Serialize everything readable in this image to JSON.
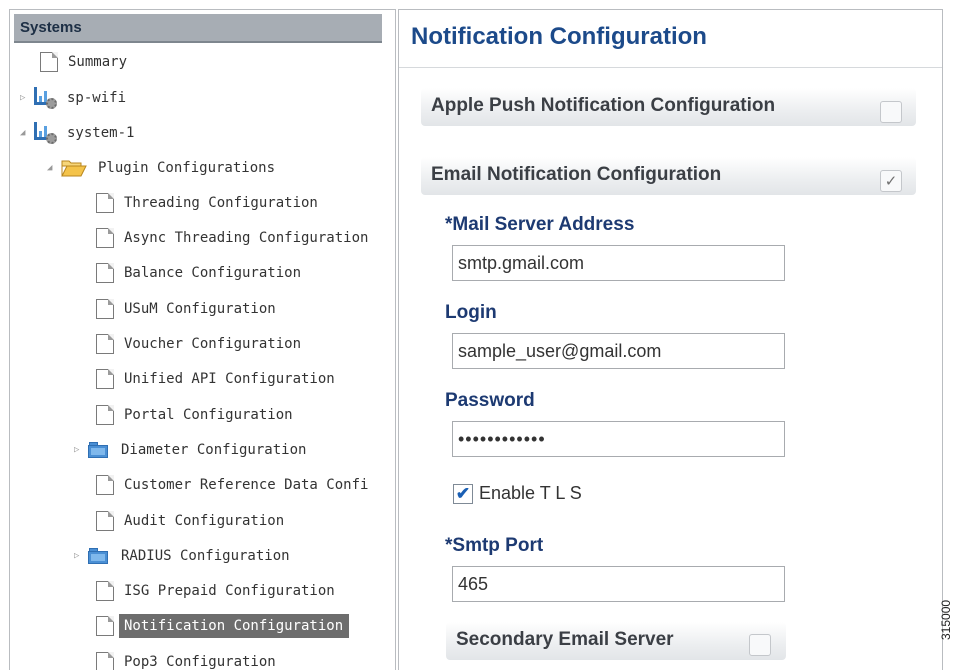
{
  "sidebar": {
    "header": "Systems",
    "items": [
      {
        "label": "Summary"
      },
      {
        "label": "sp-wifi"
      },
      {
        "label": "system-1"
      },
      {
        "label": "Plugin Configurations"
      },
      {
        "label": "Threading Configuration"
      },
      {
        "label": "Async Threading Configuration"
      },
      {
        "label": "Balance Configuration"
      },
      {
        "label": "USuM Configuration"
      },
      {
        "label": "Voucher Configuration"
      },
      {
        "label": "Unified API Configuration"
      },
      {
        "label": "Portal Configuration"
      },
      {
        "label": "Diameter Configuration"
      },
      {
        "label": "Customer Reference Data Confi"
      },
      {
        "label": "Audit Configuration"
      },
      {
        "label": "RADIUS Configuration"
      },
      {
        "label": "ISG Prepaid Configuration"
      },
      {
        "label": "Notification Configuration"
      },
      {
        "label": "Pop3 Configuration"
      }
    ],
    "selected": "Notification Configuration"
  },
  "main": {
    "title": "Notification Configuration",
    "apple_push": {
      "label": "Apple Push Notification Configuration",
      "checked": false
    },
    "email": {
      "label": "Email Notification Configuration",
      "checked": true,
      "check_glyph": "✓",
      "mail_server_label": "*Mail Server Address",
      "mail_server_value": "smtp.gmail.com",
      "login_label": "Login",
      "login_value": "sample_user@gmail.com",
      "password_label": "Password",
      "password_value": "••••••••••••",
      "tls_label": "Enable T L S",
      "tls_checked": true,
      "tls_glyph": "✔",
      "smtp_port_label": "*Smtp Port",
      "smtp_port_value": "465"
    },
    "secondary": {
      "label": "Secondary Email Server",
      "checked": false
    }
  },
  "figure_id": "315000",
  "colors": {
    "title": "#1c4a8a",
    "label": "#1d3a72",
    "selected_bg": "#6d6d6d",
    "tree_header_bg": "#a7adb4"
  },
  "icons": [
    "document-icon",
    "system-icon",
    "folder-open-icon",
    "folder-icon",
    "expand-arrow-icon",
    "collapse-arrow-icon",
    "checkbox-icon"
  ]
}
